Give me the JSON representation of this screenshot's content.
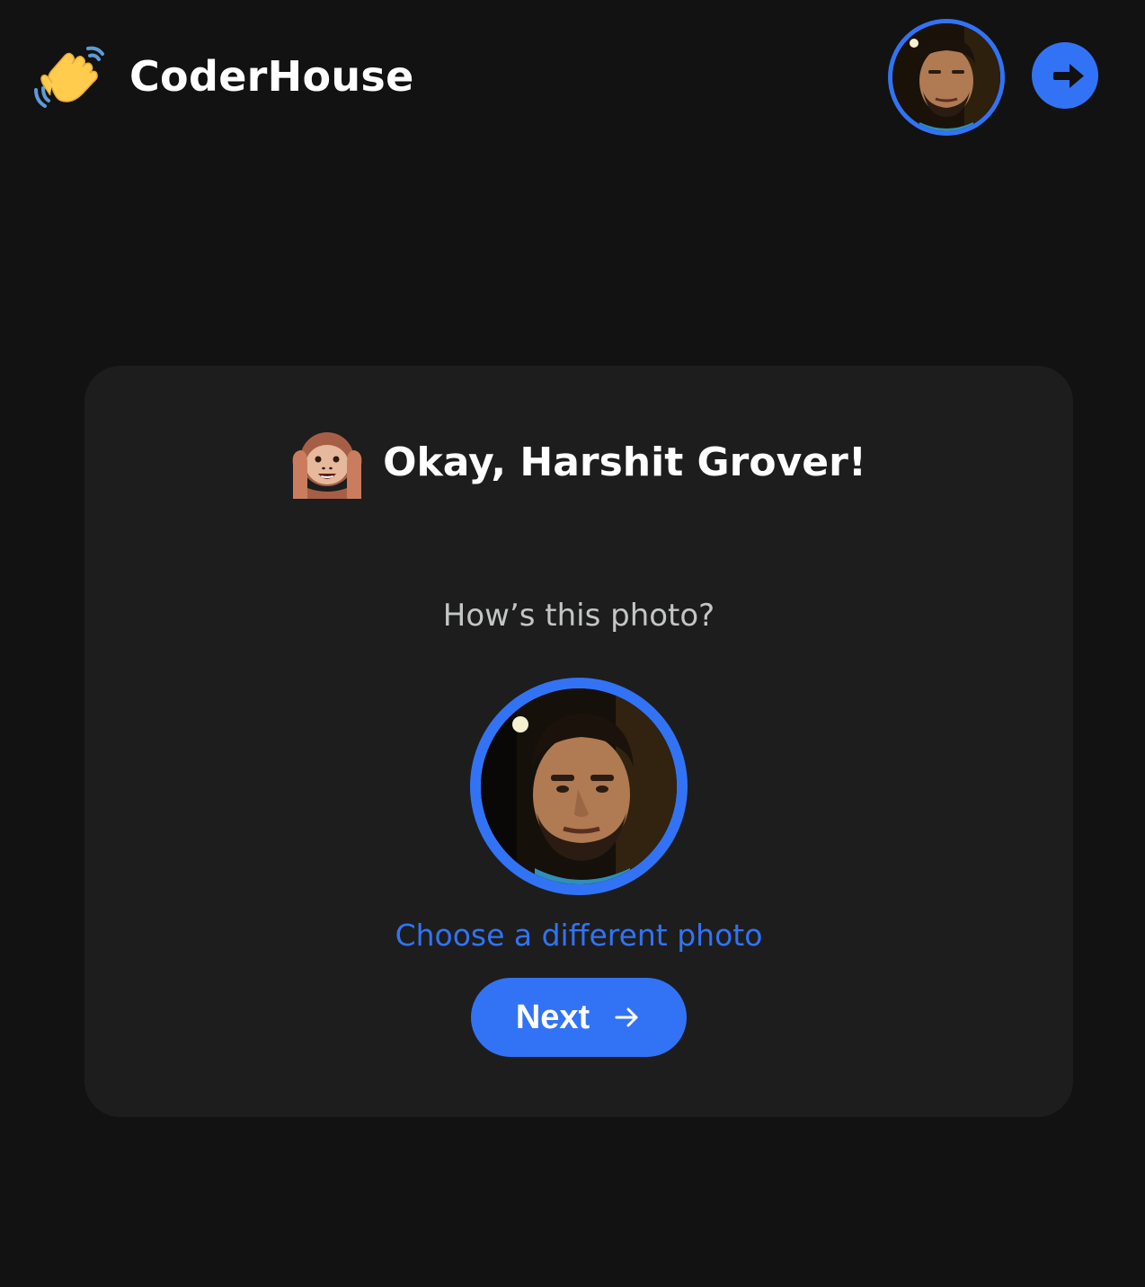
{
  "app": {
    "brand": "CoderHouse",
    "brand_icon": "waving-hand-icon"
  },
  "header": {
    "avatar_alt": "avatar",
    "logout_icon": "logout-arrow-icon"
  },
  "card": {
    "emoji_icon": "hear-no-evil-monkey-icon",
    "title": "Okay, Harshit Grover!",
    "subtitle": "How’s this photo?",
    "choose_link": "Choose a different photo",
    "next_label": "Next",
    "next_icon": "arrow-right-icon"
  },
  "colors": {
    "background": "#121212",
    "card": "#1d1d1d",
    "accent": "#3273f6",
    "subtitle_text": "#c4c5c5"
  }
}
